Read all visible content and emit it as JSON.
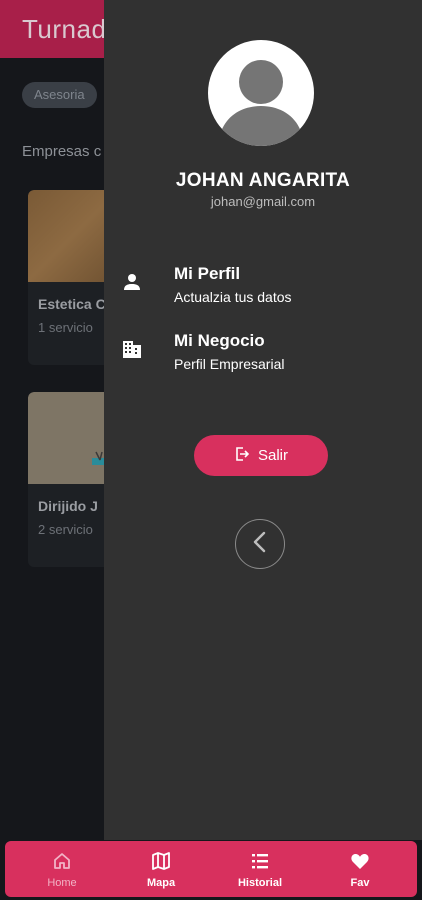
{
  "background": {
    "title": "Turnad",
    "chip": "Asesoria",
    "section_title": "Empresas c",
    "cards": [
      {
        "name": "Estetica C",
        "subtitle": "1 servicio"
      },
      {
        "name": "Dirijido J",
        "subtitle": "2 servicio"
      }
    ]
  },
  "drawer": {
    "user_name": "JOHAN ANGARITA",
    "user_email": "johan@gmail.com",
    "menu": [
      {
        "title": "Mi Perfil",
        "subtitle": "Actualzia tus datos",
        "icon": "person-icon"
      },
      {
        "title": "Mi Negocio",
        "subtitle": "Perfil Empresarial",
        "icon": "building-icon"
      }
    ],
    "logout_label": "Salir"
  },
  "bottom_nav": [
    {
      "label": "Home",
      "icon": "home-icon",
      "active": false
    },
    {
      "label": "Mapa",
      "icon": "map-icon",
      "active": true
    },
    {
      "label": "Historial",
      "icon": "list-icon",
      "active": true
    },
    {
      "label": "Fav",
      "icon": "heart-icon",
      "active": true
    }
  ],
  "colors": {
    "accent": "#d8305e",
    "header_bg": "#a81f49",
    "drawer_bg": "#313131",
    "app_bg": "#15171b"
  }
}
